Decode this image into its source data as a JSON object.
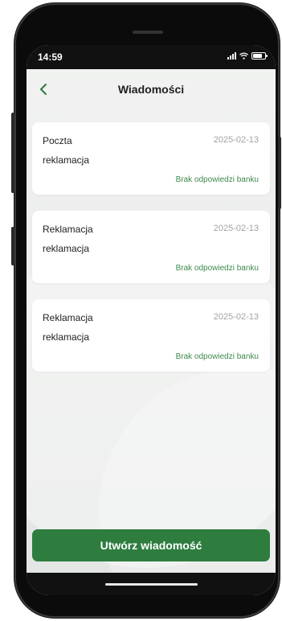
{
  "status_bar": {
    "time": "14:59",
    "battery_level": 0.75
  },
  "header": {
    "title": "Wiadomości",
    "back_icon": "chevron-left-icon"
  },
  "messages": [
    {
      "type": "Poczta",
      "date": "2025-02-13",
      "subject": "reklamacja",
      "status": "Brak odpowiedzi banku"
    },
    {
      "type": "Reklamacja",
      "date": "2025-02-13",
      "subject": "reklamacja",
      "status": "Brak odpowiedzi banku"
    },
    {
      "type": "Reklamacja",
      "date": "2025-02-13",
      "subject": "reklamacja",
      "status": "Brak odpowiedzi banku"
    }
  ],
  "actions": {
    "create_label": "Utwórz wiadomość"
  },
  "colors": {
    "accent": "#2e7d3f",
    "status_text": "#3f8a4d",
    "date_text": "#a3a3a3"
  }
}
